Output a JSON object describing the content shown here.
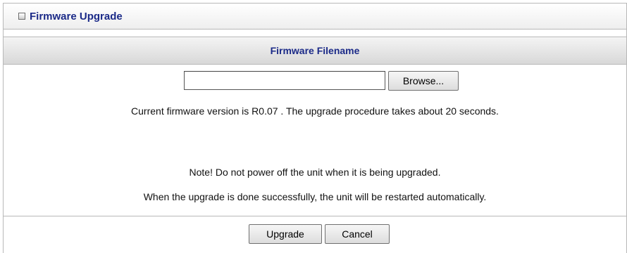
{
  "panel": {
    "title": "Firmware Upgrade",
    "title_icon": "square-bullet-icon"
  },
  "section": {
    "header": "Firmware Filename"
  },
  "file_picker": {
    "value": "",
    "browse_label": "Browse..."
  },
  "info": {
    "version_text": "Current firmware version is  R0.07 . The upgrade procedure takes about 20 seconds.",
    "note_text": "Note! Do not power off the unit when it is being upgraded.",
    "restart_text": "When the upgrade is done successfully, the unit will be restarted automatically."
  },
  "actions": {
    "upgrade_label": "Upgrade",
    "cancel_label": "Cancel"
  },
  "colors": {
    "title_text": "#1b2a88",
    "border": "#b8b8b8"
  }
}
